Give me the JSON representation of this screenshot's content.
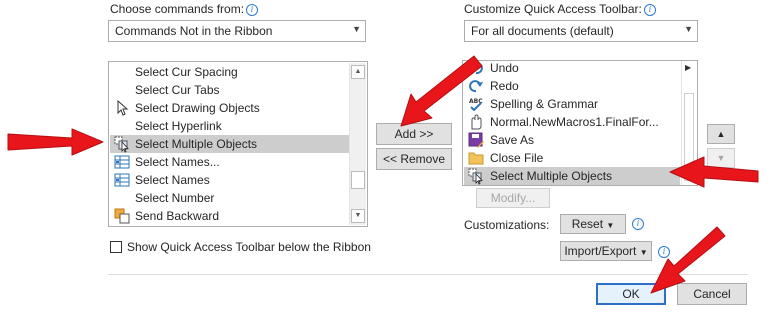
{
  "left": {
    "label": "Choose commands from:",
    "combo_value": "Commands Not in the Ribbon",
    "list_items": [
      {
        "label": "Select Cur Spacing",
        "icon": "none"
      },
      {
        "label": "Select Cur Tabs",
        "icon": "none"
      },
      {
        "label": "Select Drawing Objects",
        "icon": "pointer-icon"
      },
      {
        "label": "Select Hyperlink",
        "icon": "none"
      },
      {
        "label": "Select Multiple Objects",
        "icon": "select-multiple-objects-icon",
        "selected": true
      },
      {
        "label": "Select Names...",
        "icon": "names-grid-icon"
      },
      {
        "label": "Select Names",
        "icon": "names-grid-icon"
      },
      {
        "label": "Select Number",
        "icon": "none"
      },
      {
        "label": "Send Backward",
        "icon": "send-backward-icon"
      }
    ],
    "show_below_ribbon_label": "Show Quick Access Toolbar below the Ribbon"
  },
  "middle": {
    "add_label": "Add >>",
    "remove_label": "<< Remove"
  },
  "right": {
    "label": "Customize Quick Access Toolbar:",
    "combo_value": "For all documents (default)",
    "list_items": [
      {
        "label": "Undo",
        "icon": "undo-icon"
      },
      {
        "label": "Redo",
        "icon": "redo-icon"
      },
      {
        "label": "Spelling & Grammar",
        "icon": "spelling-icon"
      },
      {
        "label": "Normal.NewMacros1.FinalFor...",
        "icon": "macro-icon"
      },
      {
        "label": "Save As",
        "icon": "save-as-icon"
      },
      {
        "label": "Close File",
        "icon": "folder-icon"
      },
      {
        "label": "Select Multiple Objects",
        "icon": "select-multiple-objects-icon",
        "selected": true
      }
    ],
    "modify_label": "Modify...",
    "customizations_label": "Customizations:",
    "reset_label": "Reset",
    "import_export_label": "Import/Export"
  },
  "footer": {
    "ok_label": "OK",
    "cancel_label": "Cancel"
  },
  "colors": {
    "annotation_arrow": "#e8161b",
    "selection": "#cdcdcd",
    "default_button_border": "#2d6fc7",
    "info_icon": "#2b79d8"
  }
}
